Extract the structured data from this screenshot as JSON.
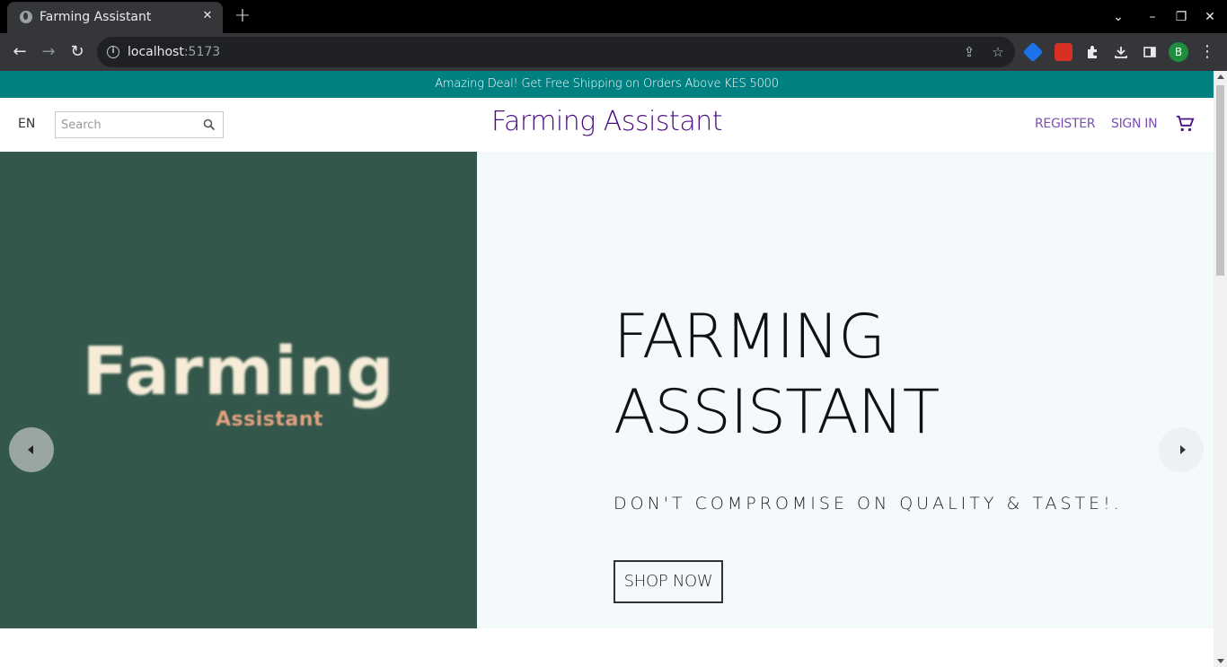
{
  "browser": {
    "tab_title": "Farming Assistant",
    "close_glyph": "✕",
    "new_tab_glyph": "+",
    "url_host": "localhost",
    "url_port": ":5173",
    "profile_initial": "B",
    "window_controls": {
      "dropdown": "⌄",
      "minimize": "–",
      "restore": "❐",
      "close": "✕"
    },
    "nav": {
      "back": "←",
      "forward": "→",
      "reload": "↻"
    },
    "omnibox_icons": {
      "share": "⇪",
      "bookmark": "☆"
    },
    "extensions": [
      "shield-extension",
      "bug-extension",
      "puzzle-extension",
      "download",
      "side-panel"
    ],
    "menu_glyph": "⋮"
  },
  "page": {
    "announcement": "Amazing Deal! Get Free Shipping on Orders Above KES 5000",
    "header": {
      "language": "EN",
      "search_placeholder": "Search",
      "logo": "Farming Assistant",
      "register": "REGISTER",
      "sign_in": "SIGN IN"
    },
    "hero": {
      "image_big": "Farming",
      "image_small": "Assistant",
      "title_line1": "FARMING",
      "title_line2": "ASSISTANT",
      "subtitle": "DON'T COMPROMISE ON QUALITY & TASTE!.",
      "cta": "SHOP NOW"
    }
  },
  "colors": {
    "announcement_bg": "#008080",
    "logo": "#4b0f7e",
    "header_links": "#7b4fb0",
    "hero_image_bg": "#33574a",
    "hero_bg": "#f4f9fb"
  }
}
